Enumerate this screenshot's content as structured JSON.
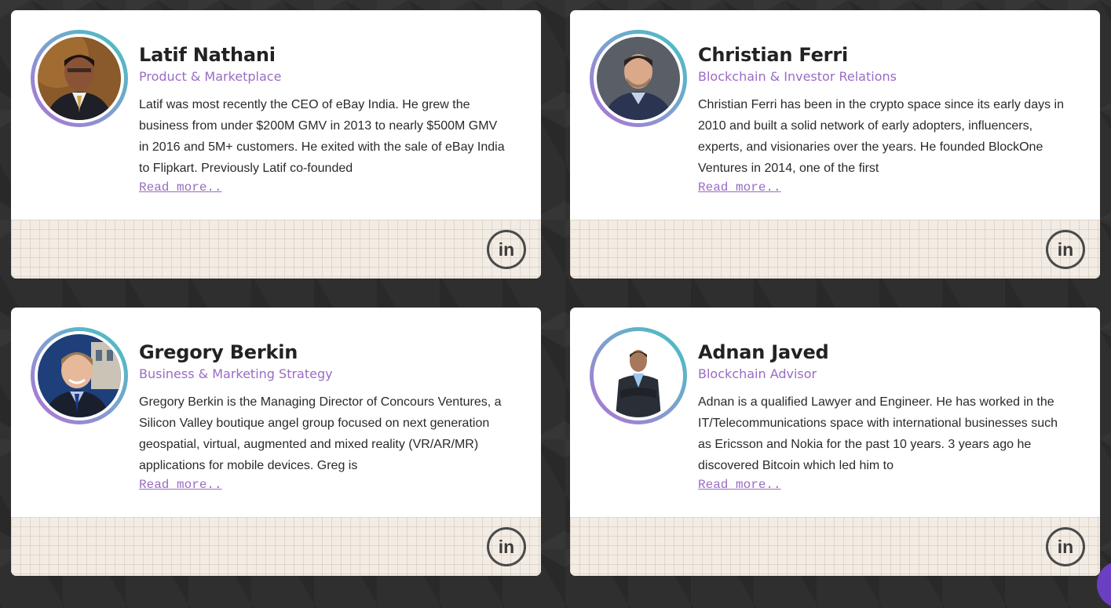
{
  "members": [
    {
      "name": "Latif Nathani",
      "role": "Product & Marketplace",
      "bio": "Latif was most recently the CEO of eBay India. He grew the business from under $200M GMV in 2013 to nearly $500M GMV in 2016 and 5M+ customers. He exited with the sale of eBay India to Flipkart. Previously Latif co-founded",
      "read_more": "Read more..",
      "linkedin": "in"
    },
    {
      "name": "Christian Ferri",
      "role": "Blockchain & Investor Relations",
      "bio": "Christian Ferri has been in the crypto space since its early days in 2010 and built a solid network of early adopters, influencers, experts, and visionaries over the years. He founded BlockOne Ventures in 2014, one of the first",
      "read_more": "Read more..",
      "linkedin": "in"
    },
    {
      "name": "Gregory Berkin",
      "role": "Business & Marketing Strategy",
      "bio": "Gregory Berkin is the Managing Director of Concours Ventures, a Silicon Valley boutique angel group focused on next generation geospatial, virtual, augmented and mixed reality (VR/AR/MR) applications for mobile devices. Greg is",
      "read_more": "Read more..",
      "linkedin": "in"
    },
    {
      "name": "Adnan Javed",
      "role": "Blockchain Advisor",
      "bio": "Adnan is a qualified Lawyer and Engineer. He has worked in the IT/Telecommunications space with international businesses such as Ericsson and Nokia for the past 10 years. 3 years ago he discovered Bitcoin which led him to",
      "read_more": "Read more..",
      "linkedin": "in"
    }
  ],
  "colors": {
    "accent": "#9b6bc4",
    "ring_start": "#3fc4c0",
    "ring_end": "#b26fd6",
    "card_footer": "#f2ece4",
    "page_background": "#2f2f2f"
  }
}
